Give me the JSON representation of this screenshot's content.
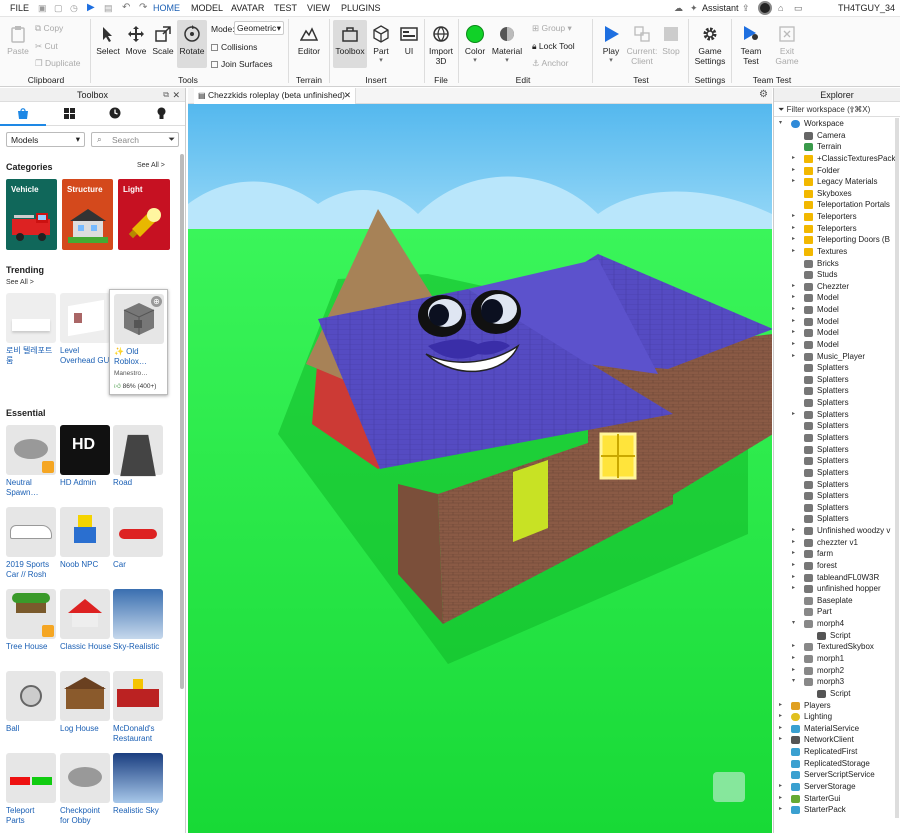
{
  "menubar": {
    "file": "FILE",
    "tabs": [
      "HOME",
      "MODEL",
      "AVATAR",
      "TEST",
      "VIEW",
      "PLUGINS"
    ],
    "assistant": "Assistant",
    "username": "TH4TGUY_34"
  },
  "ribbon": {
    "paste": "Paste",
    "copy": "Copy",
    "cut": "Cut",
    "duplicate": "Duplicate",
    "clipboard": "Clipboard",
    "select": "Select",
    "move": "Move",
    "scale": "Scale",
    "rotate": "Rotate",
    "mode_label": "Mode:",
    "mode_value": "Geometric",
    "collisions": "Collisions",
    "join_surfaces": "Join Surfaces",
    "tools": "Tools",
    "editor": "Editor",
    "terrain": "Terrain",
    "toolbox": "Toolbox",
    "part": "Part",
    "ui": "UI",
    "insert": "Insert",
    "import3d_1": "Import",
    "import3d_2": "3D",
    "file": "File",
    "color": "Color",
    "material": "Material",
    "group": "Group",
    "lock_tool": "Lock Tool",
    "anchor": "Anchor",
    "edit": "Edit",
    "play": "Play",
    "current_1": "Current:",
    "current_2": "Client",
    "stop": "Stop",
    "test": "Test",
    "game_1": "Game",
    "game_2": "Settings",
    "settings": "Settings",
    "team_1": "Team",
    "team_2": "Test",
    "exit_1": "Exit",
    "exit_2": "Game",
    "team_test": "Team Test"
  },
  "toolbox": {
    "title": "Toolbox",
    "category_select": "Models",
    "search_placeholder": "Search",
    "categories_title": "Categories",
    "see_all": "See All >",
    "categories": [
      "Vehicle",
      "Structure",
      "Light"
    ],
    "trending_title": "Trending",
    "trending_see_all": "See All >",
    "trending": [
      {
        "l1": "로비 텔레포트",
        "l2": "룸"
      },
      {
        "l1": "Level",
        "l2": "Overhead GUI"
      },
      {
        "l1": "✨ Old",
        "l2": "Roblox…",
        "creator": "Manestro…",
        "rating": "86%",
        "votes": "(400+)"
      }
    ],
    "essential_title": "Essential",
    "essential": [
      {
        "l1": "Neutral",
        "l2": "Spawn…"
      },
      {
        "l1": "HD Admin",
        "l2": ""
      },
      {
        "l1": "Road",
        "l2": ""
      },
      {
        "l1": "2019 Sports",
        "l2": "Car // Rosh"
      },
      {
        "l1": "Noob NPC",
        "l2": ""
      },
      {
        "l1": "Car",
        "l2": ""
      },
      {
        "l1": "Tree House",
        "l2": ""
      },
      {
        "l1": "Classic House",
        "l2": ""
      },
      {
        "l1": "Sky-Realistic",
        "l2": ""
      },
      {
        "l1": "Ball",
        "l2": ""
      },
      {
        "l1": "Log House",
        "l2": ""
      },
      {
        "l1": "McDonald's",
        "l2": "Restaurant"
      },
      {
        "l1": "Teleport",
        "l2": "Parts"
      },
      {
        "l1": "Checkpoint",
        "l2": "for Obby"
      },
      {
        "l1": "Realistic Sky",
        "l2": ""
      }
    ],
    "hd_text": "HD"
  },
  "viewport": {
    "tab_title": "Chezzkids roleplay (beta unfinished)"
  },
  "explorer": {
    "title": "Explorer",
    "filter_placeholder": "Filter workspace (⇧⌘X)",
    "items": [
      {
        "label": "Workspace",
        "indent": 0,
        "arrow": "▾",
        "icon": "workspace"
      },
      {
        "label": "Camera",
        "indent": 1,
        "arrow": "",
        "icon": "camera"
      },
      {
        "label": "Terrain",
        "indent": 1,
        "arrow": "",
        "icon": "terrain"
      },
      {
        "label": "+ClassicTexturesPack",
        "indent": 1,
        "arrow": "▸",
        "icon": "folder"
      },
      {
        "label": "Folder",
        "indent": 1,
        "arrow": "▸",
        "icon": "folder"
      },
      {
        "label": "Legacy Materials",
        "indent": 1,
        "arrow": "▸",
        "icon": "folder"
      },
      {
        "label": "Skyboxes",
        "indent": 1,
        "arrow": "",
        "icon": "folder"
      },
      {
        "label": "Teleportation Portals",
        "indent": 1,
        "arrow": "",
        "icon": "folder"
      },
      {
        "label": "Teleporters",
        "indent": 1,
        "arrow": "▸",
        "icon": "folder"
      },
      {
        "label": "Teleporters",
        "indent": 1,
        "arrow": "▸",
        "icon": "folder"
      },
      {
        "label": "Teleporting Doors (B",
        "indent": 1,
        "arrow": "▸",
        "icon": "folder"
      },
      {
        "label": "Textures",
        "indent": 1,
        "arrow": "▸",
        "icon": "folder"
      },
      {
        "label": "Bricks",
        "indent": 1,
        "arrow": "",
        "icon": "model"
      },
      {
        "label": "Studs",
        "indent": 1,
        "arrow": "",
        "icon": "model"
      },
      {
        "label": "Chezzter",
        "indent": 1,
        "arrow": "▸",
        "icon": "model"
      },
      {
        "label": "Model",
        "indent": 1,
        "arrow": "▸",
        "icon": "model"
      },
      {
        "label": "Model",
        "indent": 1,
        "arrow": "▸",
        "icon": "model"
      },
      {
        "label": "Model",
        "indent": 1,
        "arrow": "▸",
        "icon": "model"
      },
      {
        "label": "Model",
        "indent": 1,
        "arrow": "▸",
        "icon": "model"
      },
      {
        "label": "Model",
        "indent": 1,
        "arrow": "▸",
        "icon": "model"
      },
      {
        "label": "Music_Player",
        "indent": 1,
        "arrow": "▸",
        "icon": "model"
      },
      {
        "label": "Splatters",
        "indent": 1,
        "arrow": "",
        "icon": "model"
      },
      {
        "label": "Splatters",
        "indent": 1,
        "arrow": "",
        "icon": "model"
      },
      {
        "label": "Splatters",
        "indent": 1,
        "arrow": "",
        "icon": "model"
      },
      {
        "label": "Splatters",
        "indent": 1,
        "arrow": "",
        "icon": "model"
      },
      {
        "label": "Splatters",
        "indent": 1,
        "arrow": "▸",
        "icon": "model"
      },
      {
        "label": "Splatters",
        "indent": 1,
        "arrow": "",
        "icon": "model"
      },
      {
        "label": "Splatters",
        "indent": 1,
        "arrow": "",
        "icon": "model"
      },
      {
        "label": "Splatters",
        "indent": 1,
        "arrow": "",
        "icon": "model"
      },
      {
        "label": "Splatters",
        "indent": 1,
        "arrow": "",
        "icon": "model"
      },
      {
        "label": "Splatters",
        "indent": 1,
        "arrow": "",
        "icon": "model"
      },
      {
        "label": "Splatters",
        "indent": 1,
        "arrow": "",
        "icon": "model"
      },
      {
        "label": "Splatters",
        "indent": 1,
        "arrow": "",
        "icon": "model"
      },
      {
        "label": "Splatters",
        "indent": 1,
        "arrow": "",
        "icon": "model"
      },
      {
        "label": "Splatters",
        "indent": 1,
        "arrow": "",
        "icon": "model"
      },
      {
        "label": "Unfinished woodzy v",
        "indent": 1,
        "arrow": "▸",
        "icon": "model"
      },
      {
        "label": "chezzter v1",
        "indent": 1,
        "arrow": "▸",
        "icon": "model"
      },
      {
        "label": "farm",
        "indent": 1,
        "arrow": "▸",
        "icon": "model"
      },
      {
        "label": "forest",
        "indent": 1,
        "arrow": "▸",
        "icon": "model"
      },
      {
        "label": "tableandFL0W3R",
        "indent": 1,
        "arrow": "▸",
        "icon": "model"
      },
      {
        "label": "unfinished hopper",
        "indent": 1,
        "arrow": "▸",
        "icon": "model"
      },
      {
        "label": "Baseplate",
        "indent": 1,
        "arrow": "",
        "icon": "part"
      },
      {
        "label": "Part",
        "indent": 1,
        "arrow": "",
        "icon": "part"
      },
      {
        "label": "morph4",
        "indent": 1,
        "arrow": "▾",
        "icon": "part"
      },
      {
        "label": "Script",
        "indent": 2,
        "arrow": "",
        "icon": "script"
      },
      {
        "label": "TexturedSkybox",
        "indent": 1,
        "arrow": "▸",
        "icon": "part"
      },
      {
        "label": "morph1",
        "indent": 1,
        "arrow": "▸",
        "icon": "part"
      },
      {
        "label": "morph2",
        "indent": 1,
        "arrow": "▸",
        "icon": "part"
      },
      {
        "label": "morph3",
        "indent": 1,
        "arrow": "▾",
        "icon": "part"
      },
      {
        "label": "Script",
        "indent": 2,
        "arrow": "",
        "icon": "script"
      },
      {
        "label": "Players",
        "indent": 0,
        "arrow": "▸",
        "icon": "players"
      },
      {
        "label": "Lighting",
        "indent": 0,
        "arrow": "▸",
        "icon": "lighting"
      },
      {
        "label": "MaterialService",
        "indent": 0,
        "arrow": "▸",
        "icon": "service"
      },
      {
        "label": "NetworkClient",
        "indent": 0,
        "arrow": "▸",
        "icon": "network"
      },
      {
        "label": "ReplicatedFirst",
        "indent": 0,
        "arrow": "",
        "icon": "service"
      },
      {
        "label": "ReplicatedStorage",
        "indent": 0,
        "arrow": "",
        "icon": "service"
      },
      {
        "label": "ServerScriptService",
        "indent": 0,
        "arrow": "",
        "icon": "service"
      },
      {
        "label": "ServerStorage",
        "indent": 0,
        "arrow": "▸",
        "icon": "service"
      },
      {
        "label": "StarterGui",
        "indent": 0,
        "arrow": "▸",
        "icon": "gui"
      },
      {
        "label": "StarterPack",
        "indent": 0,
        "arrow": "▸",
        "icon": "service"
      }
    ]
  },
  "colors": {
    "accent": "#1a5fb4",
    "sky": "#66c3f0",
    "grass": "#1ff03a",
    "roof": "#5047b8",
    "folder": "#f2b800"
  }
}
